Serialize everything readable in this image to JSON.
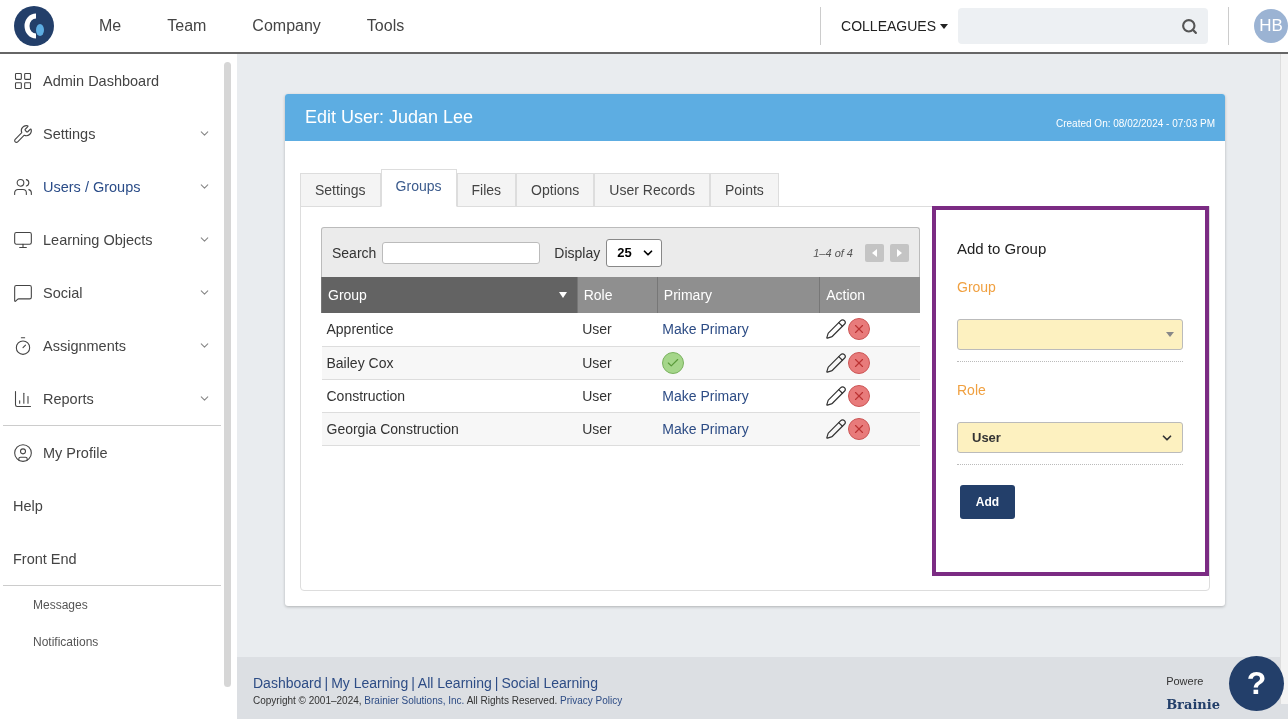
{
  "topbar": {
    "nav": [
      "Me",
      "Team",
      "Company",
      "Tools"
    ],
    "colleagues": "COLLEAGUES",
    "avatar": "HB"
  },
  "sidebar": {
    "items": [
      {
        "kind": "nav",
        "label": "Admin Dashboard",
        "expandable": false,
        "selected": false
      },
      {
        "kind": "nav",
        "label": "Settings",
        "expandable": true,
        "selected": false
      },
      {
        "kind": "nav",
        "label": "Users / Groups",
        "expandable": true,
        "selected": true
      },
      {
        "kind": "nav",
        "label": "Learning Objects",
        "expandable": true,
        "selected": false
      },
      {
        "kind": "nav",
        "label": "Social",
        "expandable": true,
        "selected": false
      },
      {
        "kind": "nav",
        "label": "Assignments",
        "expandable": true,
        "selected": false
      },
      {
        "kind": "nav",
        "label": "Reports",
        "expandable": true,
        "selected": false
      },
      {
        "kind": "divider"
      },
      {
        "kind": "nav",
        "label": "My Profile",
        "expandable": false,
        "selected": false
      },
      {
        "kind": "plain",
        "label": "Help"
      },
      {
        "kind": "plain",
        "label": "Front End"
      },
      {
        "kind": "divider"
      },
      {
        "kind": "small",
        "label": "Messages"
      },
      {
        "kind": "small",
        "label": "Notifications"
      }
    ]
  },
  "card": {
    "title": "Edit User: Judan Lee",
    "created": "Created On: 08/02/2024 - 07:03 PM",
    "tabs": [
      {
        "label": "Settings",
        "selected": false
      },
      {
        "label": "Groups",
        "selected": true
      },
      {
        "label": "Files",
        "selected": false
      },
      {
        "label": "Options",
        "selected": false
      },
      {
        "label": "User Records",
        "selected": false
      },
      {
        "label": "Points",
        "selected": false
      }
    ],
    "table": {
      "search_label": "Search",
      "display_label": "Display",
      "display_value": "25",
      "pagination": "1–4 of 4",
      "columns": [
        {
          "label": "Group",
          "sorted": true
        },
        {
          "label": "Role",
          "sorted": false
        },
        {
          "label": "Primary",
          "sorted": false
        },
        {
          "label": "Action",
          "sorted": false
        }
      ],
      "rows": [
        {
          "group": "Apprentice",
          "role": "User",
          "primary": false,
          "primary_action": "Make Primary"
        },
        {
          "group": "Bailey Cox",
          "role": "User",
          "primary": true
        },
        {
          "group": "Construction",
          "role": "User",
          "primary": false,
          "primary_action": "Make Primary"
        },
        {
          "group": "Georgia Construction",
          "role": "User",
          "primary": false,
          "primary_action": "Make Primary"
        }
      ]
    },
    "add_panel": {
      "title": "Add to Group",
      "group_label": "Group",
      "role_label": "Role",
      "role_value": "User",
      "button": "Add"
    }
  },
  "footer": {
    "links": [
      "Dashboard",
      "My Learning",
      "All Learning",
      "Social Learning"
    ],
    "separator": "|",
    "copyright": "Copyright © 2001–2024,",
    "company": "Brainier Solutions, Inc.",
    "rights": "All Rights Reserved.",
    "privacy": "Privacy Policy",
    "powered": "Powere",
    "brand": "Brainie",
    "help": "?"
  }
}
